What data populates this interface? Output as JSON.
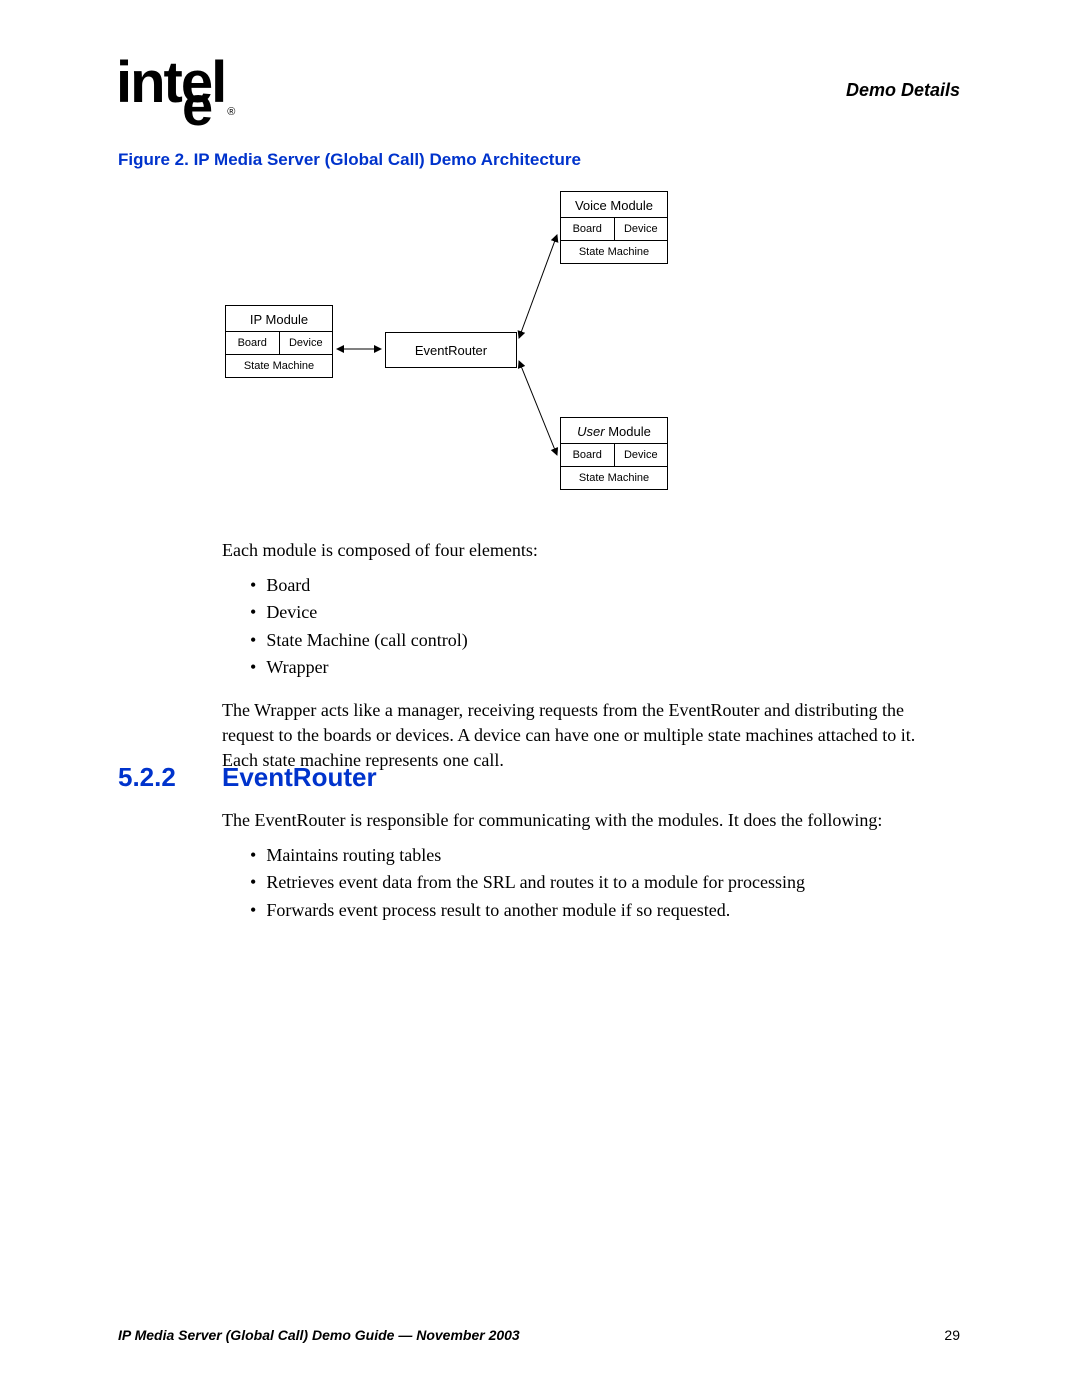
{
  "logo": {
    "text": "intel",
    "reg": "®"
  },
  "header": {
    "right": "Demo Details"
  },
  "figure_caption": "Figure 2.  IP Media Server (Global Call) Demo Architecture",
  "diagram": {
    "ip": {
      "title": "IP Module",
      "board": "Board",
      "device": "Device",
      "state": "State Machine"
    },
    "voice": {
      "title": "Voice Module",
      "board": "Board",
      "device": "Device",
      "state": "State Machine"
    },
    "user": {
      "title_prefix": "User",
      "title_suffix": " Module",
      "board": "Board",
      "device": "Device",
      "state": "State Machine"
    },
    "eventrouter": "EventRouter"
  },
  "para1": "Each module is composed of four elements:",
  "list1": {
    "0": "Board",
    "1": "Device",
    "2": "State Machine (call control)",
    "3": "Wrapper"
  },
  "para2": "The Wrapper acts like a manager, receiving requests from the EventRouter and distributing the request to the boards or devices. A device can have one or multiple state machines attached to it. Each state machine represents one call.",
  "section": {
    "num": "5.2.2",
    "title": "EventRouter"
  },
  "para3": "The EventRouter is responsible for communicating with the modules. It does the following:",
  "list2": {
    "0": "Maintains routing tables",
    "1": "Retrieves event data from the SRL and routes it to a module for processing",
    "2": "Forwards event process result to another module if so requested."
  },
  "footer": {
    "left": "IP Media Server (Global Call) Demo Guide — November 2003",
    "page": "29"
  }
}
